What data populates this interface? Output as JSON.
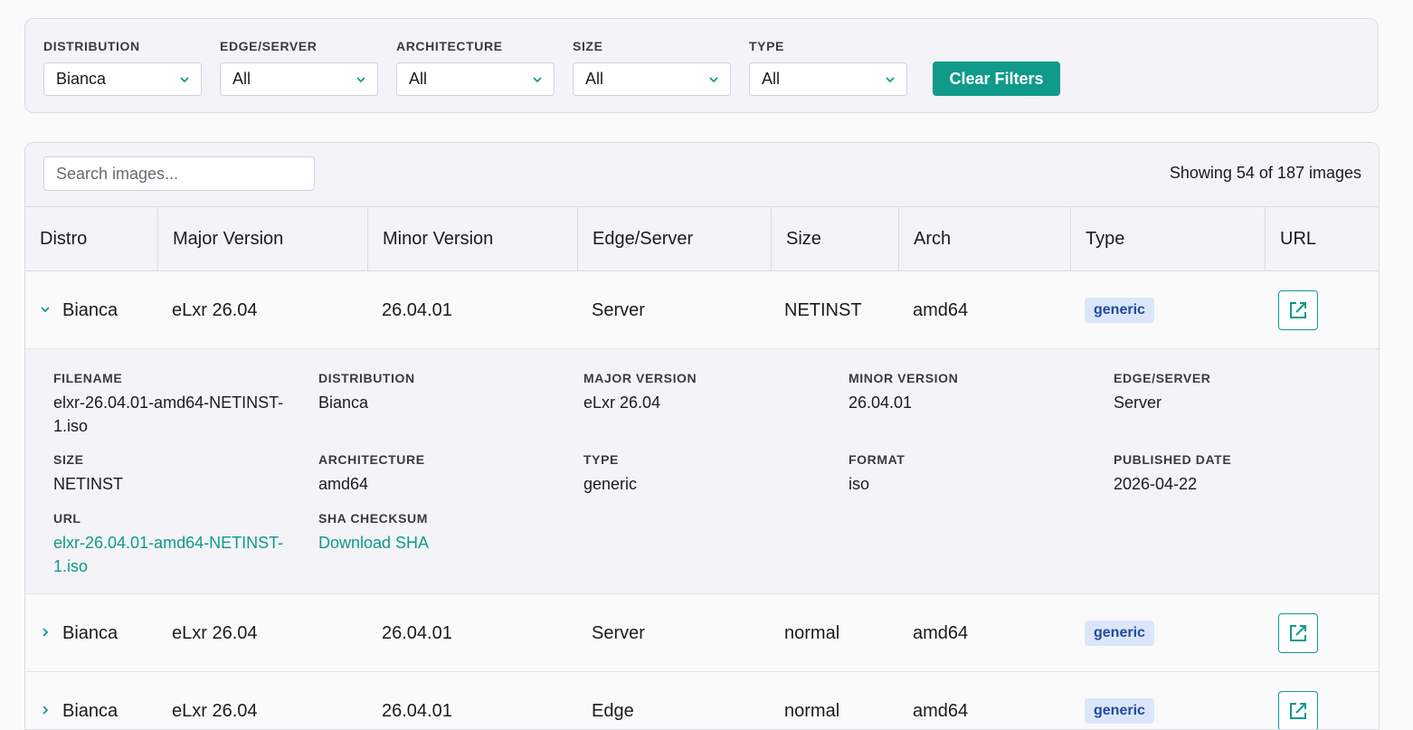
{
  "filters": {
    "groups": [
      {
        "label": "DISTRIBUTION",
        "value": "Bianca"
      },
      {
        "label": "EDGE/SERVER",
        "value": "All"
      },
      {
        "label": "ARCHITECTURE",
        "value": "All"
      },
      {
        "label": "SIZE",
        "value": "All"
      },
      {
        "label": "TYPE",
        "value": "All"
      }
    ],
    "clear_label": "Clear Filters"
  },
  "search": {
    "placeholder": "Search images..."
  },
  "count_text": "Showing 54 of 187 images",
  "columns": [
    "Distro",
    "Major Version",
    "Minor Version",
    "Edge/Server",
    "Size",
    "Arch",
    "Type",
    "URL"
  ],
  "rows": [
    {
      "distro": "Bianca",
      "major": "eLxr 26.04",
      "minor": "26.04.01",
      "edge": "Server",
      "size": "NETINST",
      "arch": "amd64",
      "type": "generic",
      "expanded": true
    },
    {
      "distro": "Bianca",
      "major": "eLxr 26.04",
      "minor": "26.04.01",
      "edge": "Server",
      "size": "normal",
      "arch": "amd64",
      "type": "generic",
      "expanded": false
    },
    {
      "distro": "Bianca",
      "major": "eLxr 26.04",
      "minor": "26.04.01",
      "edge": "Edge",
      "size": "normal",
      "arch": "amd64",
      "type": "generic",
      "expanded": false
    }
  ],
  "details": {
    "filename_label": "FILENAME",
    "filename": "elxr-26.04.01-amd64-NETINST-1.iso",
    "distribution_label": "DISTRIBUTION",
    "distribution": "Bianca",
    "major_label": "MAJOR VERSION",
    "major": "eLxr 26.04",
    "minor_label": "MINOR VERSION",
    "minor": "26.04.01",
    "edge_label": "EDGE/SERVER",
    "edge": "Server",
    "size_label": "SIZE",
    "size": "NETINST",
    "arch_label": "ARCHITECTURE",
    "arch": "amd64",
    "type_label": "TYPE",
    "type": "generic",
    "format_label": "FORMAT",
    "format": "iso",
    "published_label": "PUBLISHED DATE",
    "published": "2026-04-22",
    "url_label": "URL",
    "url": "elxr-26.04.01-amd64-NETINST-1.iso",
    "sha_label": "SHA CHECKSUM",
    "sha": "Download SHA"
  },
  "colors": {
    "accent": "#0f9a8a",
    "badge_bg": "#dbe6fb",
    "badge_text": "#214a9b"
  },
  "icons": {
    "select": "chevron-down-icon",
    "row_toggle": "chevron-icon",
    "url": "external-link-icon"
  }
}
